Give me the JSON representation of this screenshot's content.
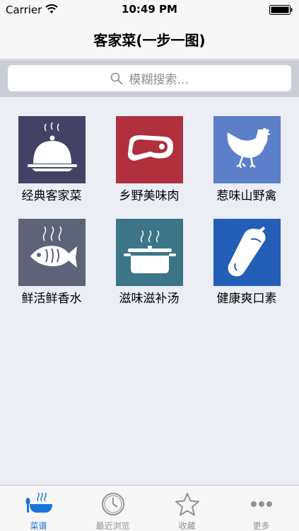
{
  "status_bar": {
    "carrier": "Carrier",
    "time": "10:49 PM"
  },
  "nav": {
    "title": "客家菜(一步一图)"
  },
  "search": {
    "placeholder": "模糊搜索..."
  },
  "categories": [
    {
      "label": "经典客家菜",
      "icon": "cloche-icon",
      "color": "#434266"
    },
    {
      "label": "乡野美味肉",
      "icon": "steak-icon",
      "color": "#b0303e"
    },
    {
      "label": "惹味山野禽",
      "icon": "chicken-icon",
      "color": "#5b7fc8"
    },
    {
      "label": "鲜活鲜香水",
      "icon": "fish-icon",
      "color": "#5d6478"
    },
    {
      "label": "滋味滋补汤",
      "icon": "soup-pot-icon",
      "color": "#3b7587"
    },
    {
      "label": "健康爽口素",
      "icon": "eggplant-icon",
      "color": "#235fb8"
    }
  ],
  "tabs": [
    {
      "label": "菜谱",
      "icon": "recipe-bowl-icon",
      "active": true
    },
    {
      "label": "最近浏览",
      "icon": "clock-icon",
      "active": false
    },
    {
      "label": "收藏",
      "icon": "star-icon",
      "active": false
    },
    {
      "label": "更多",
      "icon": "more-icon",
      "active": false
    }
  ],
  "colors": {
    "accent": "#1a73d9",
    "inactive": "#929292"
  }
}
